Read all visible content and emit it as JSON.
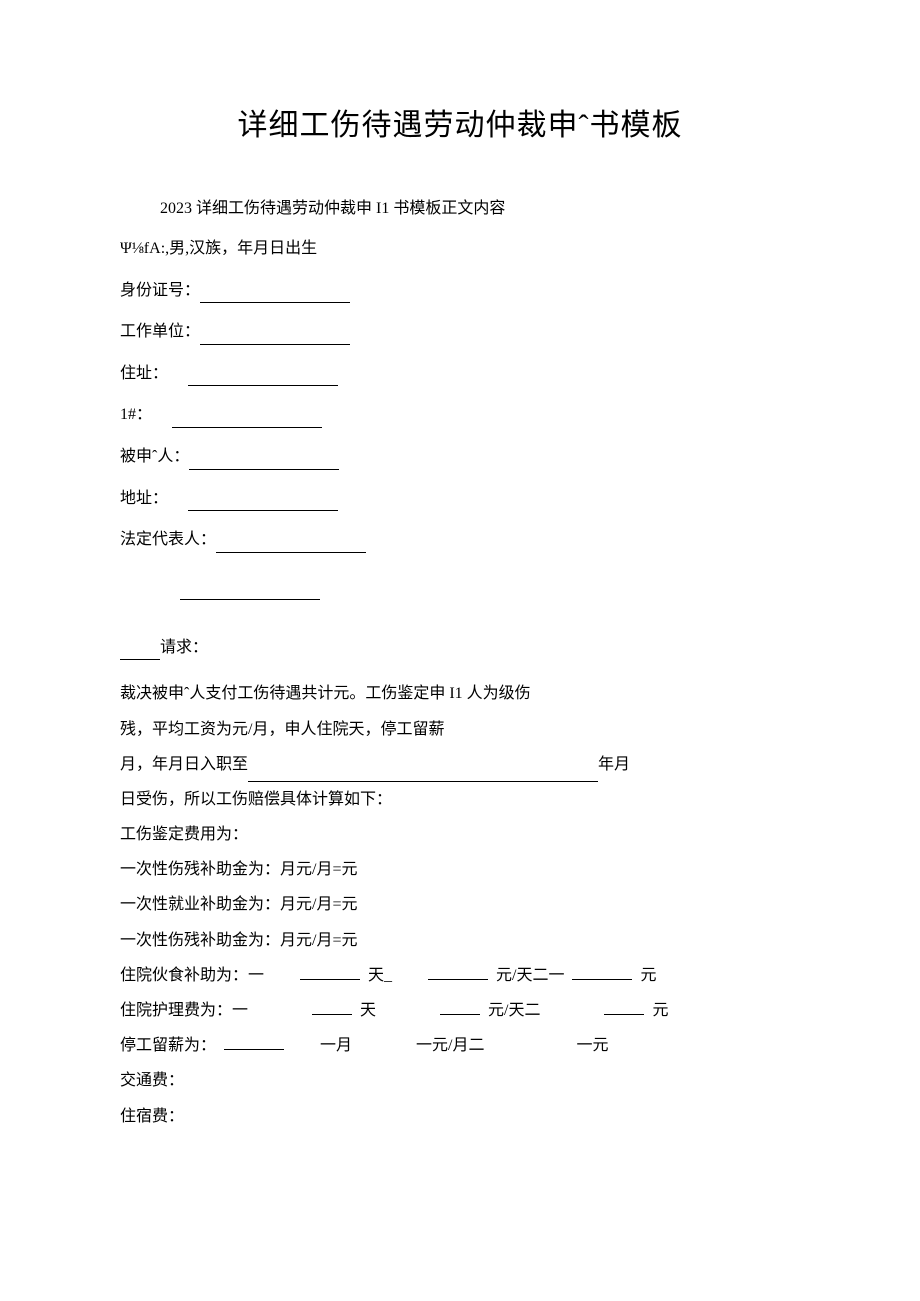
{
  "title": "详细工伤待遇劳动仲裁申ˆ书模板",
  "subtitle": "2023 详细工伤待遇劳动仲裁申 I1 书模板正文内容",
  "applicant_line": "Ψ⅛fA:,男,汉族，年月日出生",
  "fields": {
    "id_card": "身份证号：",
    "work_unit": "工作单位：",
    "address": "住址：",
    "phone": "1#：",
    "respondent": "被申ˆ人：",
    "resp_address": "地址：",
    "legal_rep": "法定代表人："
  },
  "request_label": "请求：",
  "body": {
    "p1": "裁决被申ˆ人支付工伤待遇共计元。工伤鉴定申 I1 人为级伤",
    "p2": "残，平均工资为元/月，申人住院天，停工留薪",
    "p3_pre": "月，年月日入职至",
    "p3_post": "年月",
    "p4": "日受伤，所以工伤赔偿具体计算如下：",
    "calc1": "工伤鉴定费用为：",
    "calc2": "一次性伤残补助金为：月元/月=元",
    "calc3": "一次性就业补助金为：月元/月=元",
    "calc4": "一次性伤残补助金为：月元/月=元",
    "calc5_label": "住院伙食补助为：一",
    "calc5_unit1": "天_",
    "calc5_unit2": "元/天二一",
    "calc5_unit3": "元",
    "calc6_label": "住院护理费为：一",
    "calc6_unit1": "天",
    "calc6_unit2": "元/天二",
    "calc6_unit3": "元",
    "calc7_label": "停工留薪为：",
    "calc7_unit1": "一月",
    "calc7_unit2": "一元/月二",
    "calc7_unit3": "一元",
    "calc8": "交通费：",
    "calc9": "住宿费："
  }
}
